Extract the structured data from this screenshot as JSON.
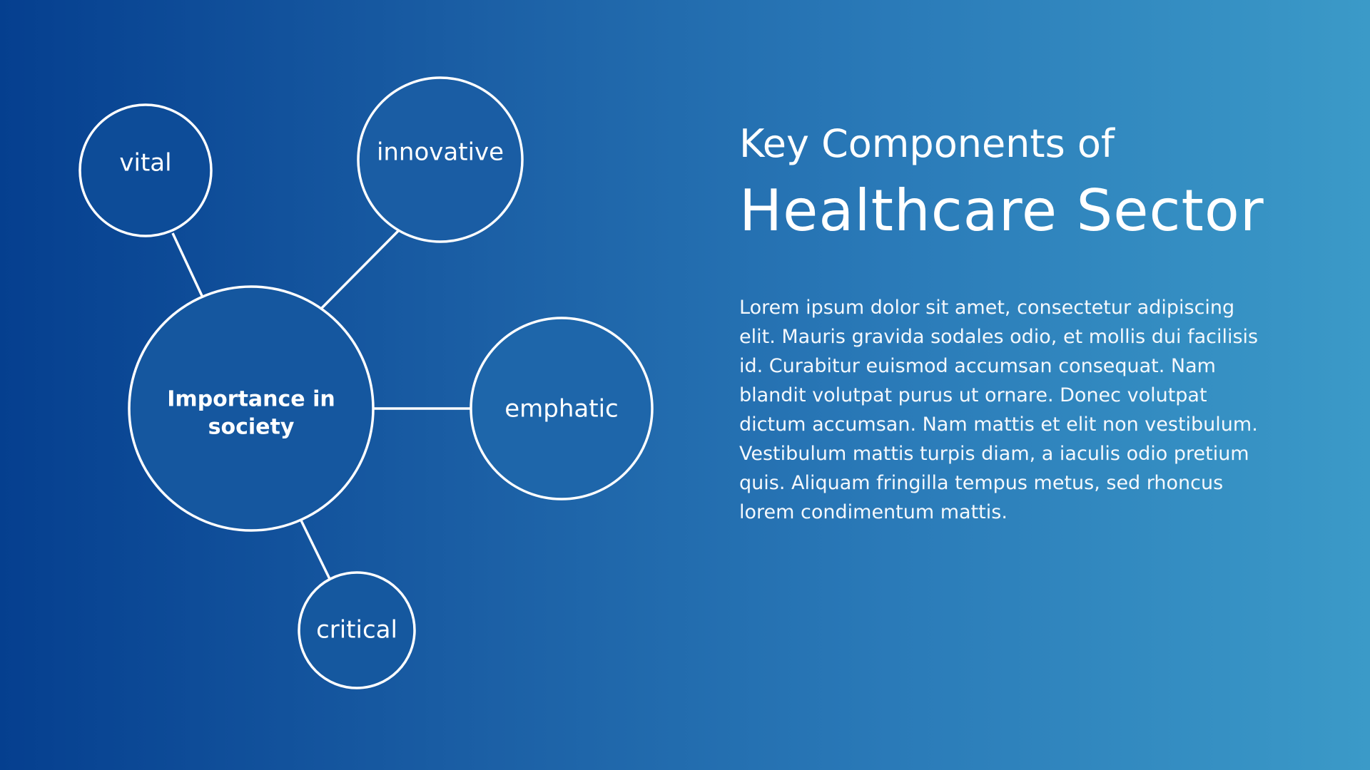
{
  "slide": {
    "title_line1": "Key Components of",
    "title_line2": "Healthcare Sector",
    "body": "Lorem ipsum dolor sit amet, consectetur adipiscing elit. Mauris gravida sodales odio, et mollis dui facilisis id. Curabitur euismod accumsan consequat. Nam blandit volutpat purus ut ornare. Donec volutpat dictum accumsan. Nam mattis et elit non vestibulum. Vestibulum mattis turpis diam, a iaculis odio pretium quis. Aliquam fringilla tempus metus, sed rhoncus lorem condimentum mattis."
  },
  "diagram": {
    "hub": {
      "line1": "Importance in",
      "line2": "society"
    },
    "nodes": {
      "vital": "vital",
      "innovative": "innovative",
      "emphatic": "emphatic",
      "critical": "critical"
    }
  },
  "colors": {
    "gradient_start": "#053f8f",
    "gradient_end": "#3b9ac8",
    "bubble_fill": "#15579f",
    "stroke": "#ffffff"
  }
}
